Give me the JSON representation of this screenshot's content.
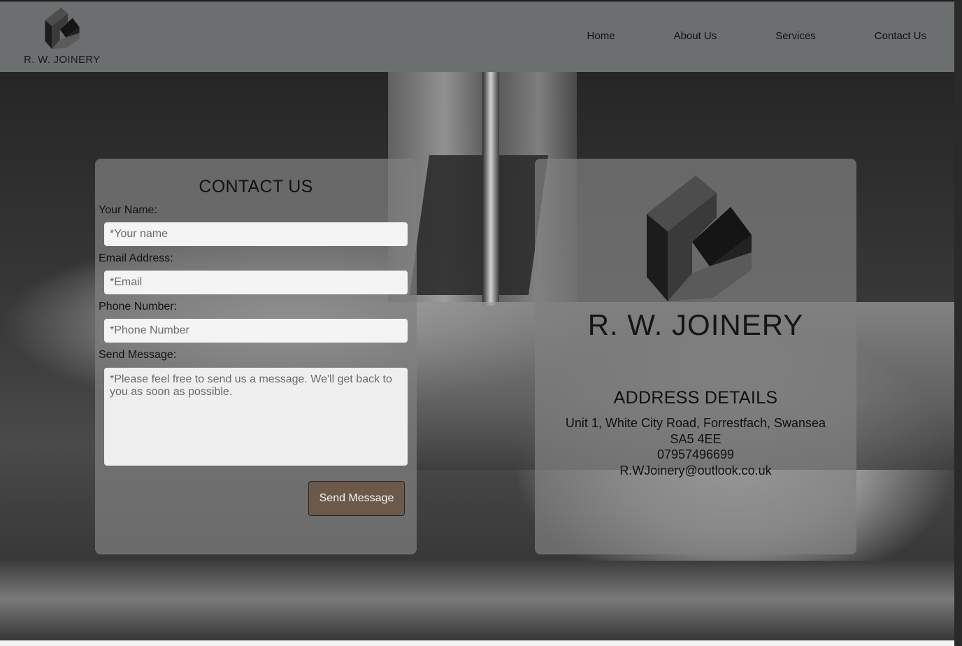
{
  "header": {
    "brand": "R. W. JOINERY",
    "nav": [
      {
        "label": "Home"
      },
      {
        "label": "About Us"
      },
      {
        "label": "Services"
      },
      {
        "label": "Contact Us"
      }
    ]
  },
  "contact_form": {
    "title": "CONTACT US",
    "name_label": "Your Name:",
    "name_placeholder": "*Your name",
    "email_label": "Email Address:",
    "email_placeholder": "*Email",
    "phone_label": "Phone Number:",
    "phone_placeholder": "*Phone Number",
    "message_label": "Send Message:",
    "message_placeholder": "*Please feel free to send us a message. We'll get back to you as soon as possible.",
    "submit_label": "Send Message"
  },
  "info_panel": {
    "brand": "R. W. JOINERY",
    "title": "ADDRESS DETAILS",
    "address_line": "Unit 1, White City Road, Forrestfach, Swansea",
    "postcode": "SA5 4EE",
    "phone": "07957496699",
    "email": "R.WJoinery@outlook.co.uk"
  },
  "colors": {
    "header_bg": "#6b6f70",
    "panel_bg": "#808080",
    "button_bg": "#6b5a4c"
  }
}
